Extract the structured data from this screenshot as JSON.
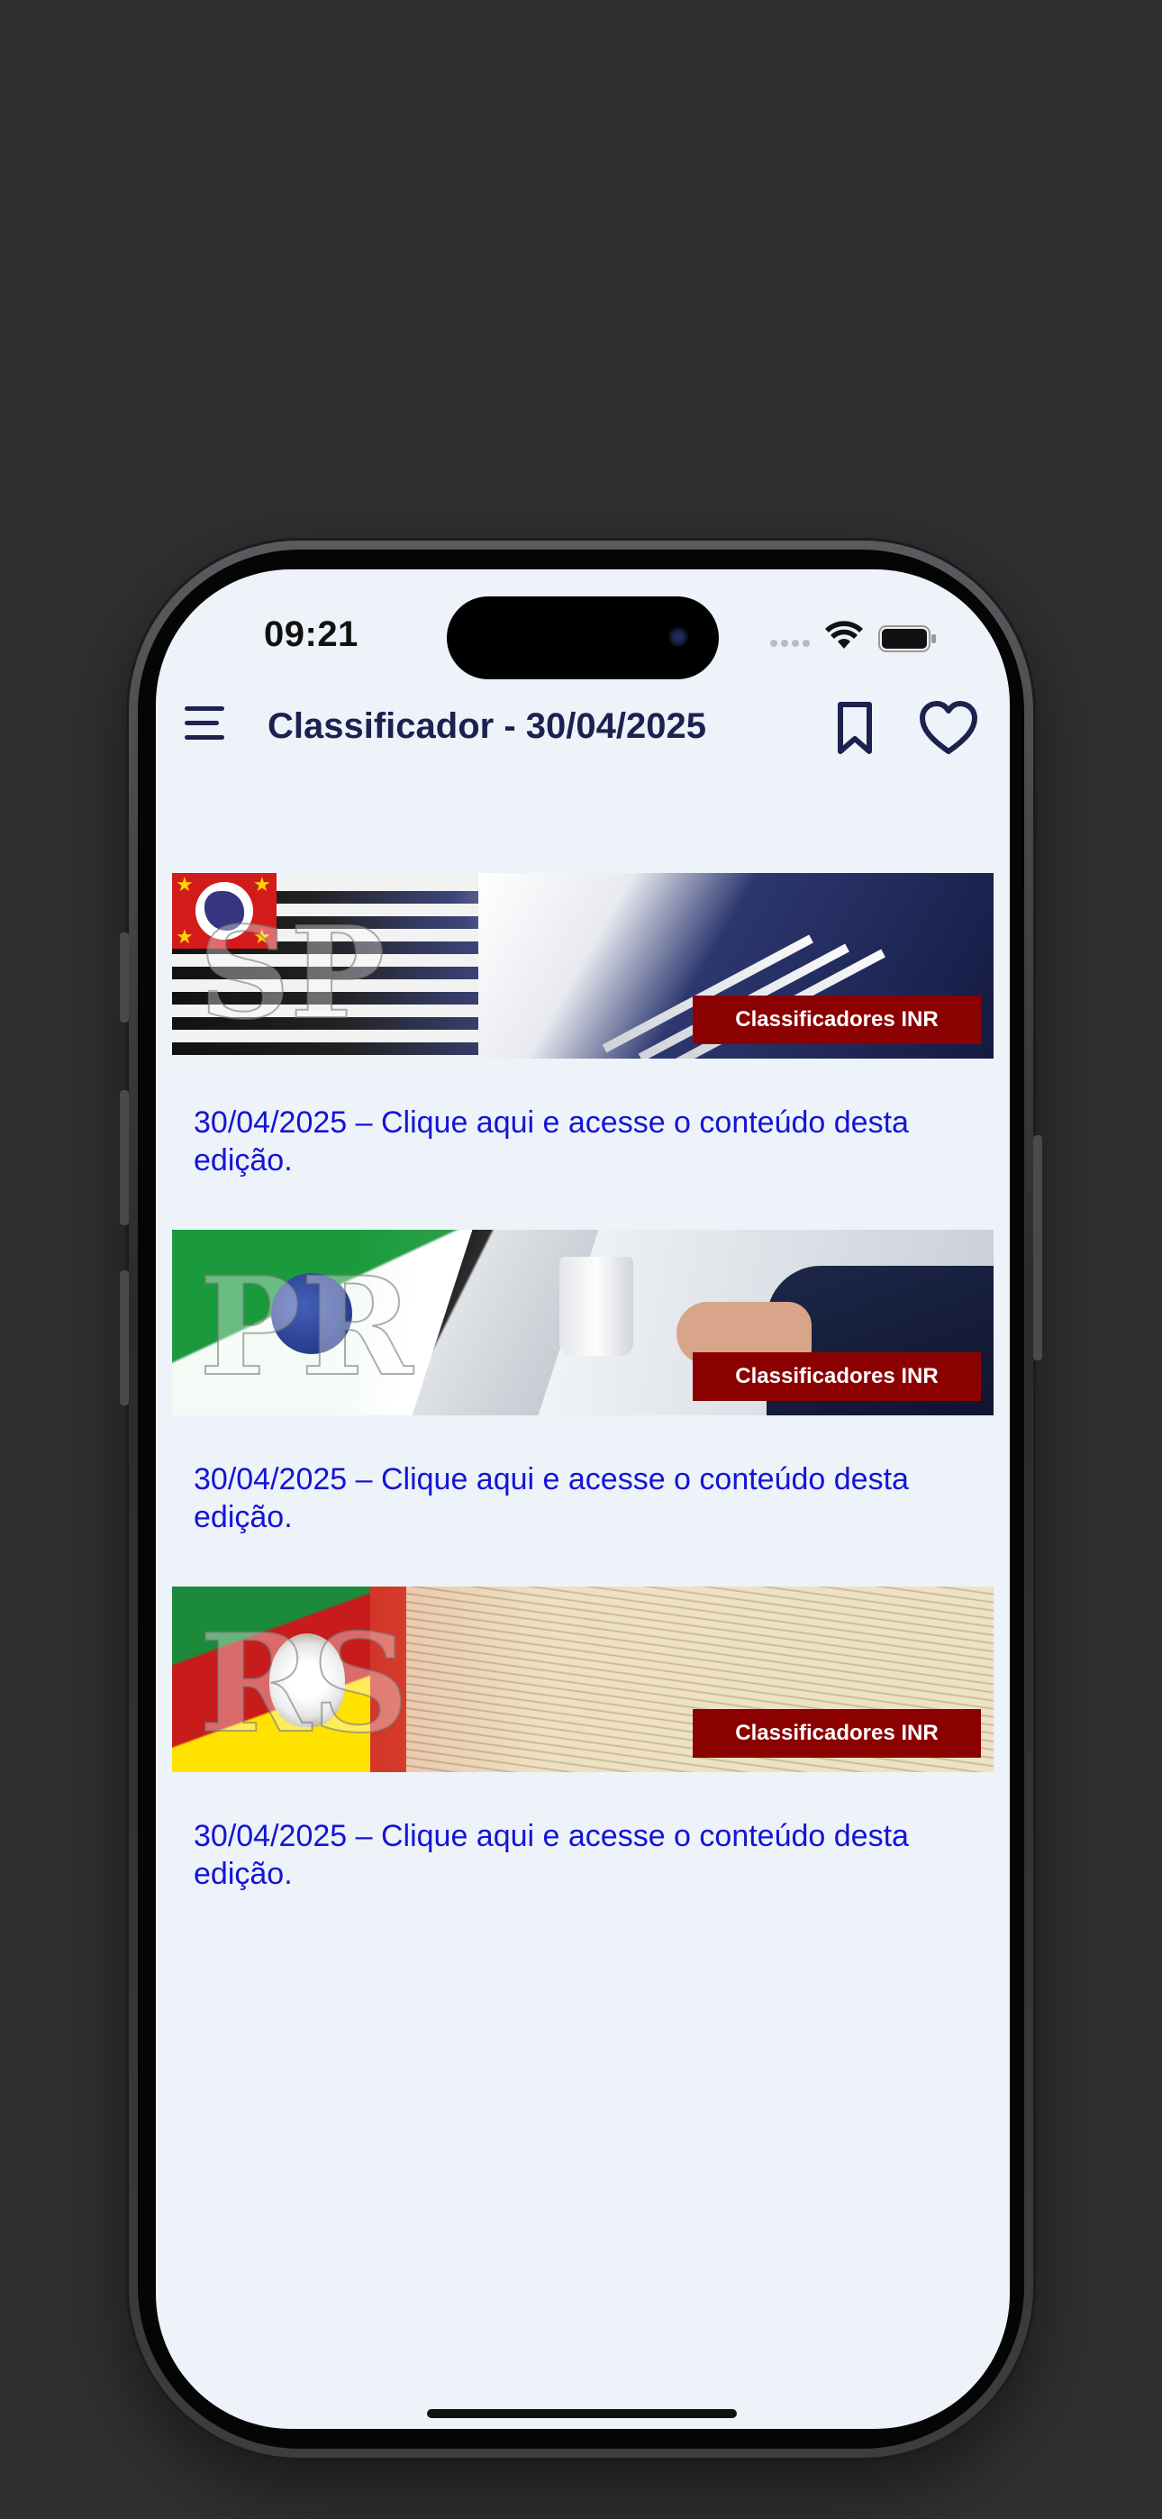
{
  "status_bar": {
    "time": "09:21"
  },
  "appbar": {
    "title": "Classificador - 30/04/2025"
  },
  "cards": [
    {
      "banner_label": "Classificadores INR",
      "banner_letters": "SP",
      "link_text": "30/04/2025 – Clique aqui e acesse o conteúdo desta edição."
    },
    {
      "banner_label": "Classificadores INR",
      "banner_letters": "PR",
      "link_text": "30/04/2025 – Clique aqui e acesse o conteúdo desta edição."
    },
    {
      "banner_label": "Classificadores INR",
      "banner_letters": "RS",
      "link_text": "30/04/2025 – Clique aqui e acesse o conteúdo desta edição."
    }
  ],
  "icons": {
    "menu": "hamburger-menu-icon",
    "bookmark": "bookmark-icon",
    "favorite": "heart-icon"
  },
  "colors": {
    "title": "#1d2150",
    "link": "#1414d6",
    "banner_label_bg": "#8b0000",
    "screen_bg": "#edf3f8"
  }
}
